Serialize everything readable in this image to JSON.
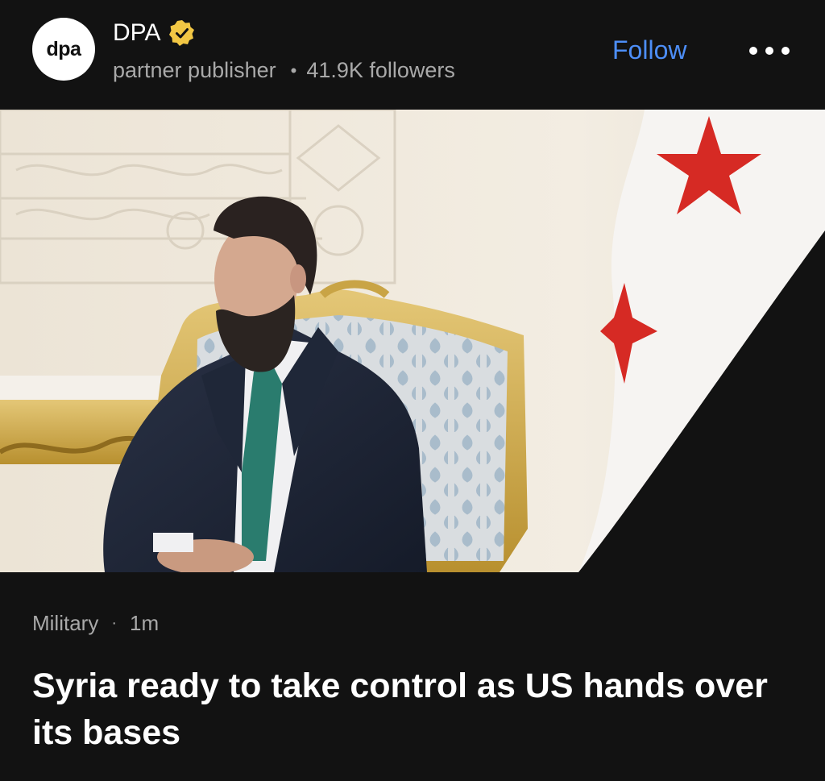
{
  "header": {
    "avatar_text": "dpa",
    "publisher_name": "DPA",
    "publisher_type": "partner publisher",
    "followers": "41.9K followers",
    "follow_label": "Follow",
    "more_icon": "more-horizontal-icon",
    "verified_icon": "verified-badge-icon",
    "verified_color": "#f2c744",
    "follow_color": "#4d8ef7"
  },
  "article": {
    "category": "Military",
    "time": "1m",
    "headline": "Syria ready to take control as US hands over its bases"
  }
}
